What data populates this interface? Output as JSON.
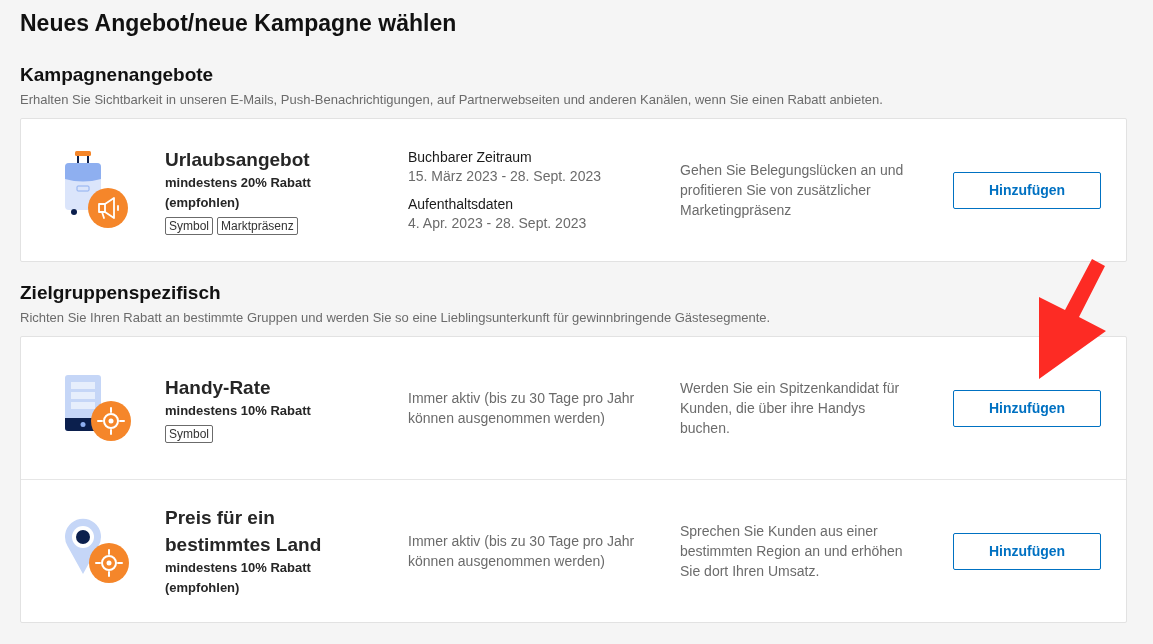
{
  "page_title": "Neues Angebot/neue Kampagne wählen",
  "sections": [
    {
      "heading": "Kampagnenangebote",
      "description": "Erhalten Sie Sichtbarkeit in unseren E-Mails, Push-Benachrichtigungen, auf Partnerwebseiten und anderen Kanälen, wenn Sie einen Rabatt anbieten.",
      "offers": [
        {
          "kind": "vacation",
          "title": "Urlaubsangebot",
          "discount": "mindestens 20% Rabatt (empfohlen)",
          "tags": [
            "Symbol",
            "Marktpräsenz"
          ],
          "periods": [
            {
              "label": "Buchbarer Zeitraum",
              "dates": "15. März 2023 - 28. Sept. 2023"
            },
            {
              "label": "Aufenthaltsdaten",
              "dates": "4. Apr. 2023 - 28. Sept. 2023"
            }
          ],
          "benefit": "Gehen Sie Belegungslücken an und profitieren Sie von zusätzlicher Marketingpräsenz",
          "button": "Hinzufügen"
        }
      ]
    },
    {
      "heading": "Zielgruppenspezifisch",
      "description": "Richten Sie Ihren Rabatt an bestimmte Gruppen und werden Sie so eine Lieblingsunterkunft für gewinnbringende Gästesegmente.",
      "offers": [
        {
          "kind": "mobile",
          "title": "Handy-Rate",
          "discount": "mindestens 10% Rabatt",
          "tags": [
            "Symbol"
          ],
          "availability": "Immer aktiv (bis zu 30 Tage pro Jahr können ausgenommen werden)",
          "benefit": "Werden Sie ein Spitzenkandidat für Kunden, die über ihre Handys buchen.",
          "button": "Hinzufügen"
        },
        {
          "kind": "country",
          "title": "Preis für ein bestimmtes Land",
          "discount": "mindestens 10% Rabatt (empfohlen)",
          "availability": "Immer aktiv (bis zu 30 Tage pro Jahr können ausgenommen werden)",
          "benefit": "Sprechen Sie Kunden aus einer bestimmten Region an und erhöhen Sie dort Ihren Umsatz.",
          "button": "Hinzufügen"
        }
      ]
    }
  ],
  "annotation": {
    "kind": "arrow"
  }
}
